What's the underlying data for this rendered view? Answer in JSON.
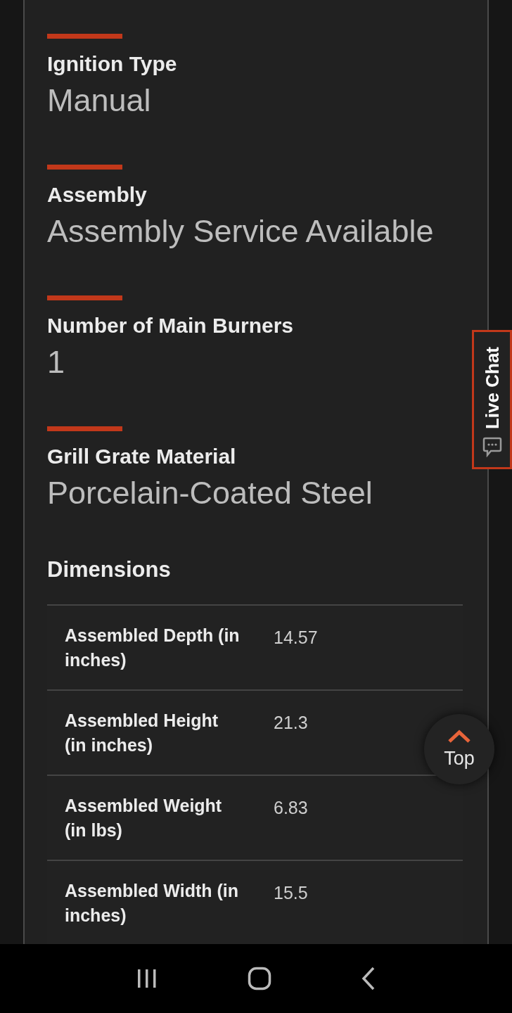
{
  "specs": [
    {
      "label": "Ignition Type",
      "value": "Manual"
    },
    {
      "label": "Assembly",
      "value": "Assembly Service Available"
    },
    {
      "label": "Number of Main Burners",
      "value": "1"
    },
    {
      "label": "Grill Grate Material",
      "value": "Porcelain-Coated Steel"
    }
  ],
  "dimensions": {
    "heading": "Dimensions",
    "rows": [
      {
        "label": "Assembled Depth (in inches)",
        "value": "14.57"
      },
      {
        "label": "Assembled Height (in inches)",
        "value": "21.3"
      },
      {
        "label": "Assembled Weight (in lbs)",
        "value": "6.83"
      },
      {
        "label": "Assembled Width (in inches)",
        "value": "15.5"
      }
    ]
  },
  "live_chat": {
    "label": "Live Chat"
  },
  "top_button": {
    "label": "Top"
  }
}
